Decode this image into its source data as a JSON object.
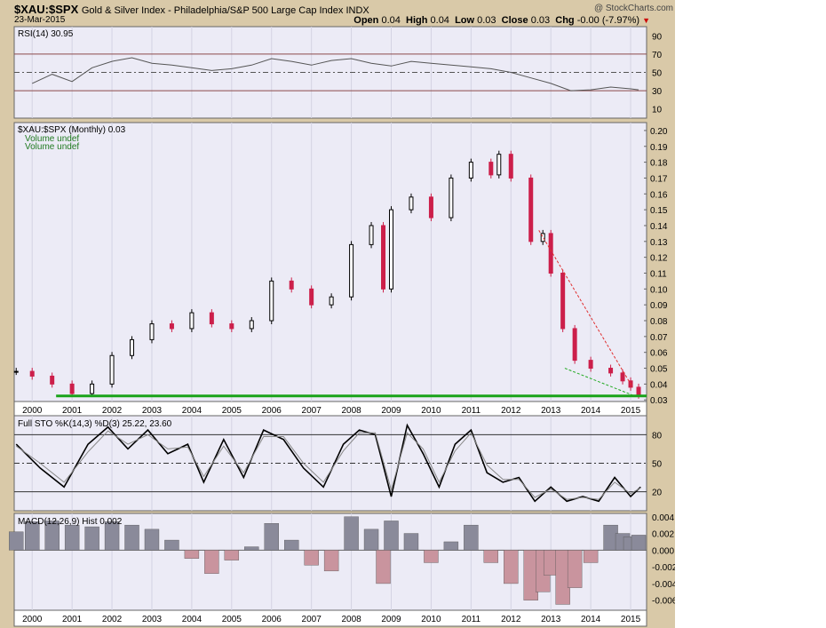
{
  "header": {
    "symbol": "$XAU:$SPX",
    "description": "Gold & Silver Index - Philadelphia/S&P 500 Large Cap Index  INDX",
    "date": "23-Mar-2015",
    "brand": "@ StockCharts.com",
    "ohlc": {
      "open_label": "Open",
      "open": "0.04",
      "high_label": "High",
      "high": "0.04",
      "low_label": "Low",
      "low": "0.03",
      "close_label": "Close",
      "close": "0.03",
      "chg_label": "Chg",
      "chg": "-0.00 (-7.97%)"
    },
    "down_color": "#cc0000"
  },
  "colors": {
    "panel_bg": "#ecebf6",
    "frame": "#d9c9a8",
    "up_candle": "#000000",
    "down_candle": "#cc1f4a",
    "support": "#1aa31a",
    "trend_red": "#e03030",
    "trend_green": "#22aa22",
    "macd_pos": "#8a8a9a",
    "macd_neg": "#c9949e"
  },
  "chart_data": [
    {
      "type": "line",
      "panel": "rsi",
      "label": "RSI(14) 30.95",
      "yticks": [
        90,
        70,
        50,
        30,
        10
      ],
      "ylim": [
        0,
        100
      ],
      "reference_lines": [
        70,
        50,
        30
      ],
      "x": [
        2000,
        2000.5,
        2001,
        2001.5,
        2002,
        2002.5,
        2003,
        2003.5,
        2004,
        2004.5,
        2005,
        2005.5,
        2006,
        2006.5,
        2007,
        2007.5,
        2008,
        2008.5,
        2009,
        2009.5,
        2010,
        2010.5,
        2011,
        2011.5,
        2012,
        2012.5,
        2013,
        2013.5,
        2014,
        2014.5,
        2015,
        2015.2
      ],
      "values": [
        38,
        48,
        40,
        55,
        62,
        66,
        60,
        58,
        55,
        52,
        54,
        58,
        65,
        62,
        58,
        63,
        65,
        60,
        57,
        62,
        60,
        58,
        56,
        54,
        50,
        44,
        38,
        30,
        31,
        34,
        32,
        31
      ]
    },
    {
      "type": "candlestick",
      "panel": "price",
      "label": "$XAU:$SPX (Monthly) 0.03",
      "volume_labels": [
        "Volume undef",
        "Volume undef"
      ],
      "yticks": [
        0.2,
        0.19,
        0.18,
        0.17,
        0.16,
        0.15,
        0.14,
        0.13,
        0.12,
        0.11,
        0.1,
        0.09,
        0.08,
        0.07,
        0.06,
        0.05,
        0.04,
        0.03
      ],
      "ylim": [
        0.029,
        0.205
      ],
      "xlim": [
        1999.55,
        2015.4
      ],
      "year_ticks": [
        "2000",
        "2001",
        "2002",
        "2003",
        "2004",
        "2005",
        "2006",
        "2007",
        "2008",
        "2009",
        "2010",
        "2011",
        "2012",
        "2013",
        "2014",
        "2015"
      ],
      "x": [
        1999.6,
        2000,
        2000.5,
        2001,
        2001.5,
        2002,
        2002.5,
        2003,
        2003.5,
        2004,
        2004.5,
        2005,
        2005.5,
        2006,
        2006.5,
        2007,
        2007.5,
        2008,
        2008.5,
        2008.8,
        2009,
        2009.5,
        2010,
        2010.5,
        2011,
        2011.5,
        2011.7,
        2012,
        2012.5,
        2012.8,
        2013,
        2013.3,
        2013.6,
        2014,
        2014.5,
        2014.8,
        2015,
        2015.2
      ],
      "close": [
        0.048,
        0.045,
        0.04,
        0.034,
        0.04,
        0.058,
        0.068,
        0.078,
        0.075,
        0.085,
        0.078,
        0.075,
        0.08,
        0.105,
        0.1,
        0.09,
        0.095,
        0.128,
        0.14,
        0.1,
        0.15,
        0.158,
        0.145,
        0.17,
        0.18,
        0.172,
        0.185,
        0.17,
        0.13,
        0.135,
        0.11,
        0.075,
        0.055,
        0.05,
        0.047,
        0.042,
        0.038,
        0.033
      ],
      "support_line": 0.0325,
      "trend_red": {
        "x": [
          2012.7,
          2015.05
        ],
        "y": [
          0.137,
          0.038
        ]
      },
      "trend_green": {
        "x": [
          2013.35,
          2015.05
        ],
        "y": [
          0.05,
          0.033
        ]
      }
    },
    {
      "type": "line",
      "panel": "stochastic",
      "label": "Full STO %K(14,3) %D(3) 25.22, 23.60",
      "yticks": [
        80,
        50,
        20
      ],
      "ylim": [
        0,
        100
      ],
      "reference_lines": [
        80,
        50,
        20
      ],
      "series": [
        {
          "name": "%K",
          "x": [
            1999.6,
            2000.2,
            2000.8,
            2001.4,
            2001.9,
            2002.4,
            2002.9,
            2003.4,
            2003.9,
            2004.3,
            2004.8,
            2005.3,
            2005.8,
            2006.3,
            2006.8,
            2007.3,
            2007.8,
            2008.2,
            2008.6,
            2009.0,
            2009.4,
            2009.8,
            2010.2,
            2010.6,
            2011.0,
            2011.4,
            2011.8,
            2012.2,
            2012.6,
            2013.0,
            2013.4,
            2013.8,
            2014.2,
            2014.6,
            2015.0,
            2015.25
          ],
          "values": [
            70,
            45,
            25,
            70,
            88,
            65,
            85,
            60,
            70,
            30,
            75,
            35,
            85,
            75,
            45,
            25,
            70,
            85,
            80,
            15,
            90,
            60,
            25,
            70,
            85,
            40,
            30,
            35,
            10,
            25,
            10,
            15,
            10,
            35,
            15,
            25
          ]
        },
        {
          "name": "%D",
          "x": [
            1999.6,
            2000.2,
            2000.8,
            2001.4,
            2001.9,
            2002.4,
            2002.9,
            2003.4,
            2003.9,
            2004.3,
            2004.8,
            2005.3,
            2005.8,
            2006.3,
            2006.8,
            2007.3,
            2007.8,
            2008.2,
            2008.6,
            2009.0,
            2009.4,
            2009.8,
            2010.2,
            2010.6,
            2011.0,
            2011.4,
            2011.8,
            2012.2,
            2012.6,
            2013.0,
            2013.4,
            2013.8,
            2014.2,
            2014.6,
            2015.0,
            2015.25
          ],
          "values": [
            68,
            50,
            30,
            62,
            84,
            70,
            80,
            65,
            67,
            36,
            68,
            40,
            78,
            78,
            50,
            30,
            63,
            82,
            82,
            22,
            82,
            65,
            30,
            63,
            82,
            48,
            33,
            33,
            14,
            23,
            12,
            14,
            12,
            30,
            18,
            24
          ]
        }
      ]
    },
    {
      "type": "bar",
      "panel": "macd",
      "label": "MACD(12,26,9) Hist 0.002",
      "yticks": [
        "0.004",
        "0.002",
        "0.000",
        "-0.002",
        "-0.004",
        "-0.006"
      ],
      "ylim": [
        -0.0072,
        0.0044
      ],
      "x": [
        1999.6,
        2000,
        2000.5,
        2001,
        2001.5,
        2002,
        2002.5,
        2003,
        2003.5,
        2004,
        2004.5,
        2005,
        2005.5,
        2006,
        2006.5,
        2007,
        2007.5,
        2008,
        2008.5,
        2008.8,
        2009,
        2009.5,
        2010,
        2010.5,
        2011,
        2011.5,
        2012,
        2012.5,
        2012.8,
        2013,
        2013.3,
        2013.6,
        2014,
        2014.5,
        2014.8,
        2015,
        2015.2
      ],
      "values": [
        0.0022,
        0.0034,
        0.0035,
        0.003,
        0.0028,
        0.0034,
        0.003,
        0.0025,
        0.0012,
        -0.001,
        -0.0028,
        -0.0012,
        0.0004,
        0.0032,
        0.0012,
        -0.0018,
        -0.0025,
        0.004,
        0.0025,
        -0.004,
        0.0035,
        0.002,
        -0.0015,
        0.001,
        0.003,
        -0.0015,
        -0.004,
        -0.006,
        -0.005,
        -0.003,
        -0.0065,
        -0.0045,
        -0.0015,
        0.003,
        0.002,
        0.0016,
        0.0018
      ]
    }
  ]
}
